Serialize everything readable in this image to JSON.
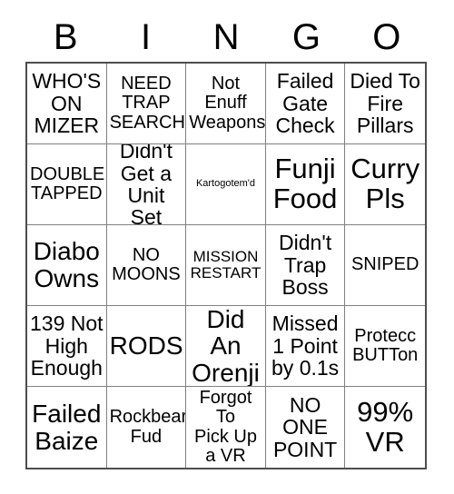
{
  "header": {
    "letters": [
      "B",
      "I",
      "N",
      "G",
      "O"
    ]
  },
  "grid": {
    "rows": 5,
    "columns": 5,
    "border_color": "#4d4d4d",
    "line_color": "#808080",
    "background_color": "#ffffff",
    "text_color": "#000000",
    "cells": [
      {
        "text": "WHO'S\nON\nMIZER",
        "size": "l"
      },
      {
        "text": "NEED\nTRAP\nSEARCH",
        "size": "m"
      },
      {
        "text": "Not Enuff\nWeapons",
        "size": "m"
      },
      {
        "text": "Failed\nGate\nCheck",
        "size": "l"
      },
      {
        "text": "Died To\nFire\nPillars",
        "size": "l"
      },
      {
        "text": "DOUBLE\nTAPPED",
        "size": "m"
      },
      {
        "text": "Didn't\nGet a\nUnit Set",
        "size": "l"
      },
      {
        "text": "Kartogotem'd",
        "size": "xs"
      },
      {
        "text": "Funji\nFood",
        "size": "xxl"
      },
      {
        "text": "Curry\nPls",
        "size": "xxl"
      },
      {
        "text": "Diabo\nOwns",
        "size": "xl"
      },
      {
        "text": "NO\nMOONS",
        "size": "m"
      },
      {
        "text": "MISSION\nRESTART",
        "size": "s"
      },
      {
        "text": "Didn't\nTrap\nBoss",
        "size": "l"
      },
      {
        "text": "SNIPED",
        "size": "m"
      },
      {
        "text": "139 Not\nHigh\nEnough",
        "size": "l"
      },
      {
        "text": "RODS",
        "size": "xl"
      },
      {
        "text": "Did An\nOrenji",
        "size": "xl"
      },
      {
        "text": "Missed\n1 Point\nby 0.1s",
        "size": "l"
      },
      {
        "text": "Protecc\nBUTTon",
        "size": "m"
      },
      {
        "text": "Failed\nBaize",
        "size": "xl"
      },
      {
        "text": "Rockbear\nFud",
        "size": "m"
      },
      {
        "text": "Forgot To\nPick Up\na VR",
        "size": "m"
      },
      {
        "text": "NO\nONE\nPOINT",
        "size": "l"
      },
      {
        "text": "99%\nVR",
        "size": "xxl"
      }
    ]
  }
}
